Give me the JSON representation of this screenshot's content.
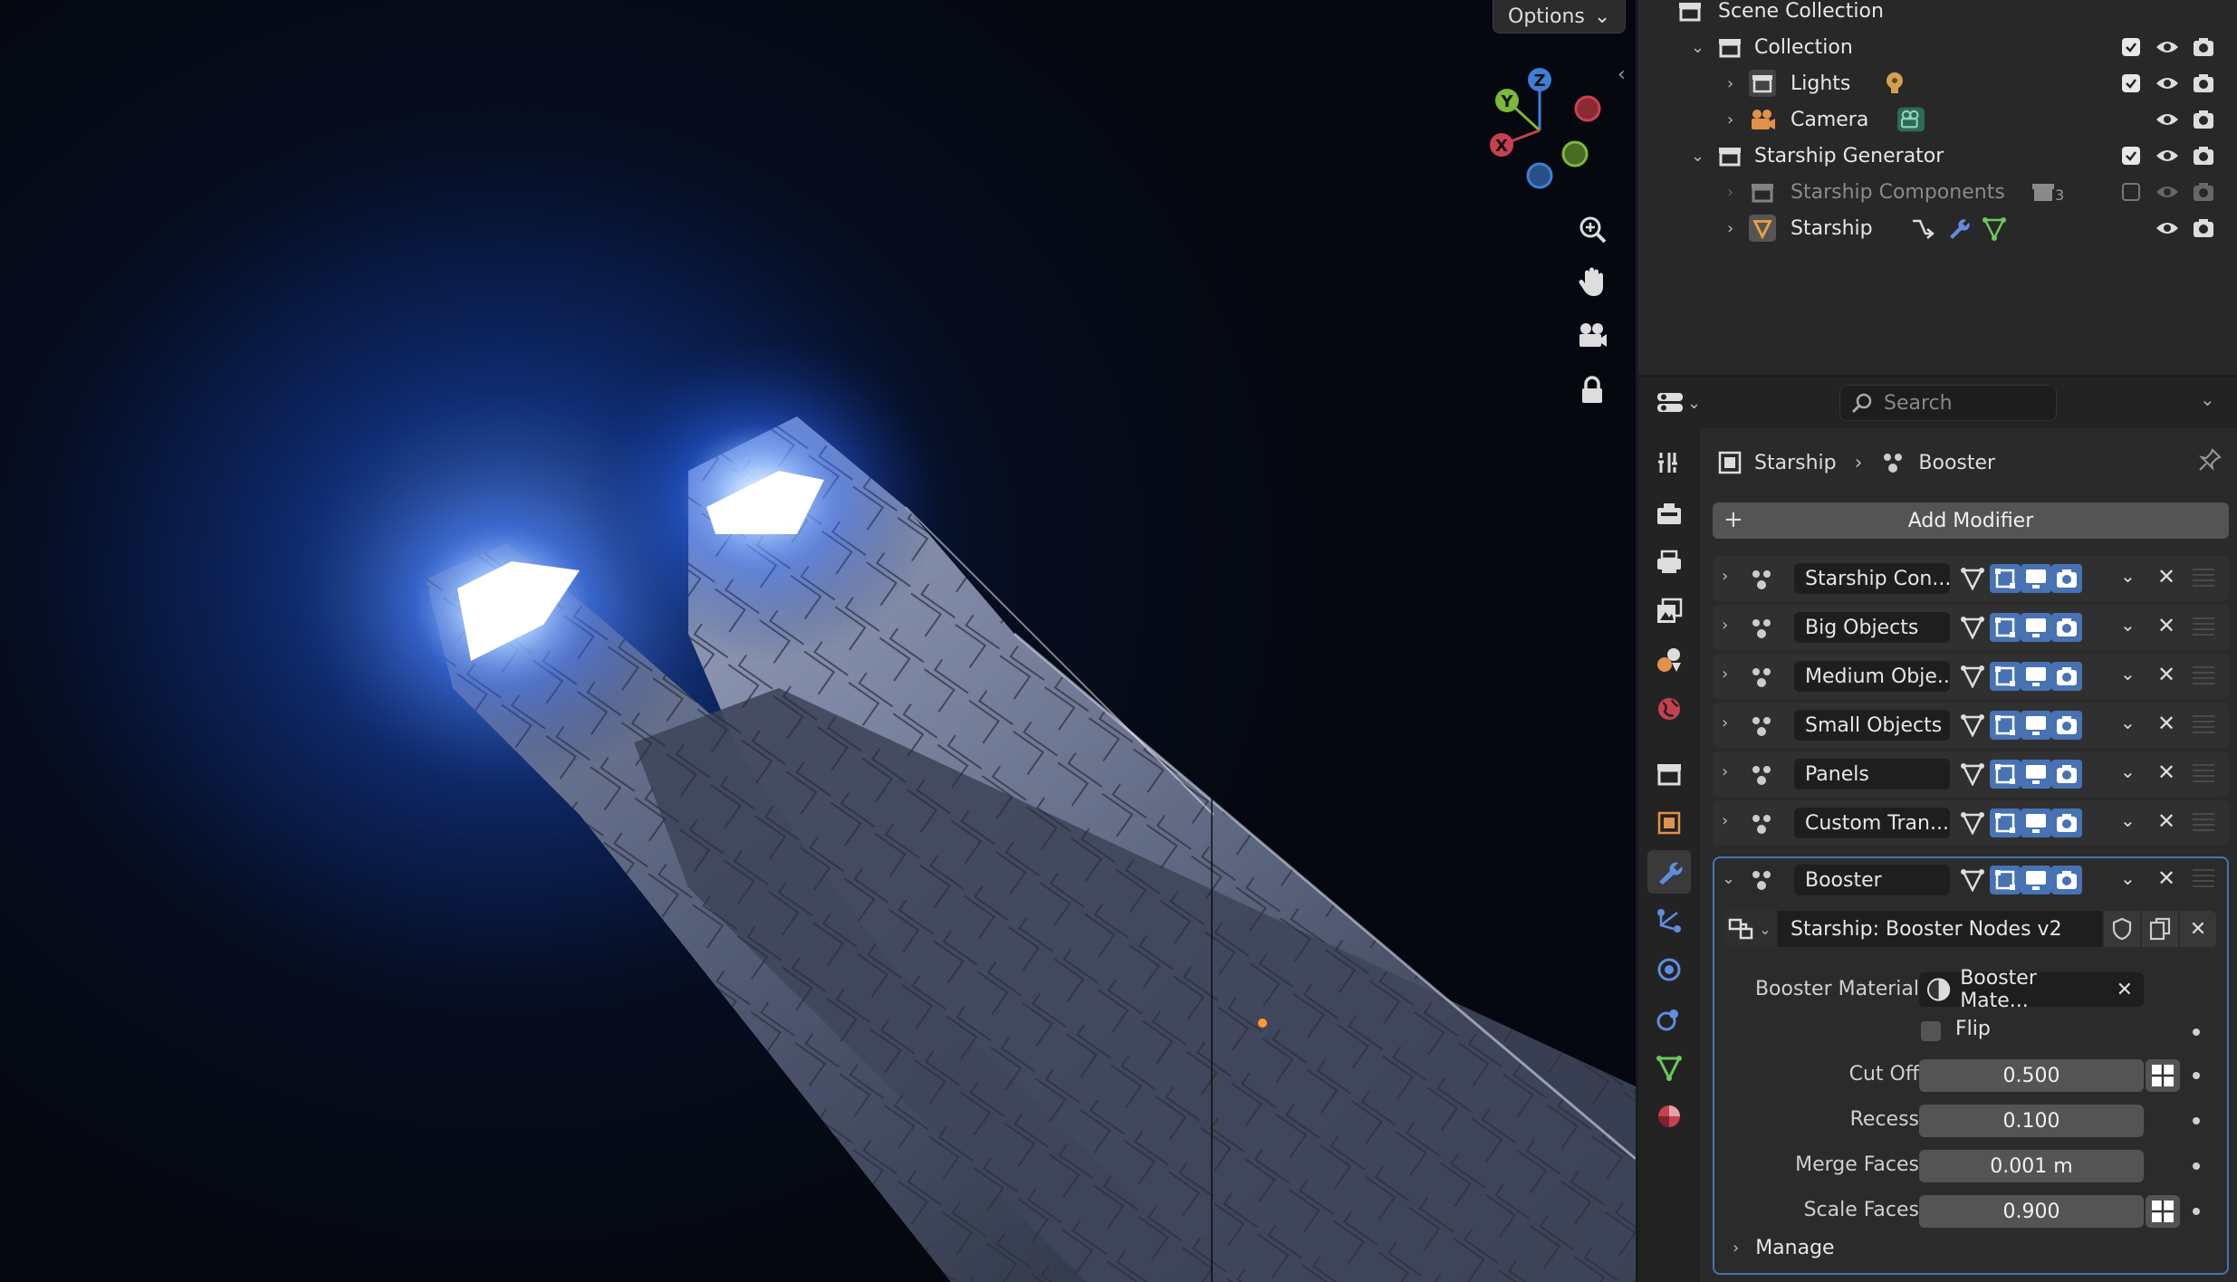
{
  "viewport": {
    "options_label": "Options",
    "gizmo": {
      "y_label": "Y",
      "z_label": "Z",
      "x_label": "X"
    },
    "nav_icons": [
      "zoom-in-icon",
      "hand-pan-icon",
      "camera-view-icon",
      "lock-icon"
    ]
  },
  "outliner": {
    "rows": [
      {
        "label": "Scene Collection"
      },
      {
        "label": "Collection"
      },
      {
        "label": "Lights"
      },
      {
        "label": "Camera"
      },
      {
        "label": "Starship Generator"
      },
      {
        "label": "Starship Components",
        "badge": "3"
      },
      {
        "label": "Starship"
      }
    ]
  },
  "properties": {
    "search_placeholder": "Search",
    "breadcrumb": {
      "object": "Starship",
      "modifier": "Booster"
    },
    "add_modifier_label": "Add Modifier",
    "modifiers": [
      {
        "name": "Starship Con..."
      },
      {
        "name": "Big Objects"
      },
      {
        "name": "Medium Obje..."
      },
      {
        "name": "Small Objects"
      },
      {
        "name": "Panels"
      },
      {
        "name": "Custom Tran..."
      },
      {
        "name": "Booster"
      }
    ],
    "booster": {
      "node_group": "Starship: Booster Nodes v2",
      "material_label": "Booster Material",
      "material_value": "Booster Mate...",
      "flip_label": "Flip",
      "fields": [
        {
          "label": "Cut Off",
          "value": "0.500"
        },
        {
          "label": "Recess",
          "value": "0.100"
        },
        {
          "label": "Merge Faces",
          "value": "0.001 m"
        },
        {
          "label": "Scale Faces",
          "value": "0.900"
        }
      ],
      "manage_label": "Manage"
    }
  },
  "colors": {
    "accent_blue": "#4772b3",
    "axis_x": "#c8404f",
    "axis_y": "#7cb83a",
    "axis_z": "#3d7fd6",
    "glow": "#7fb2ff"
  }
}
